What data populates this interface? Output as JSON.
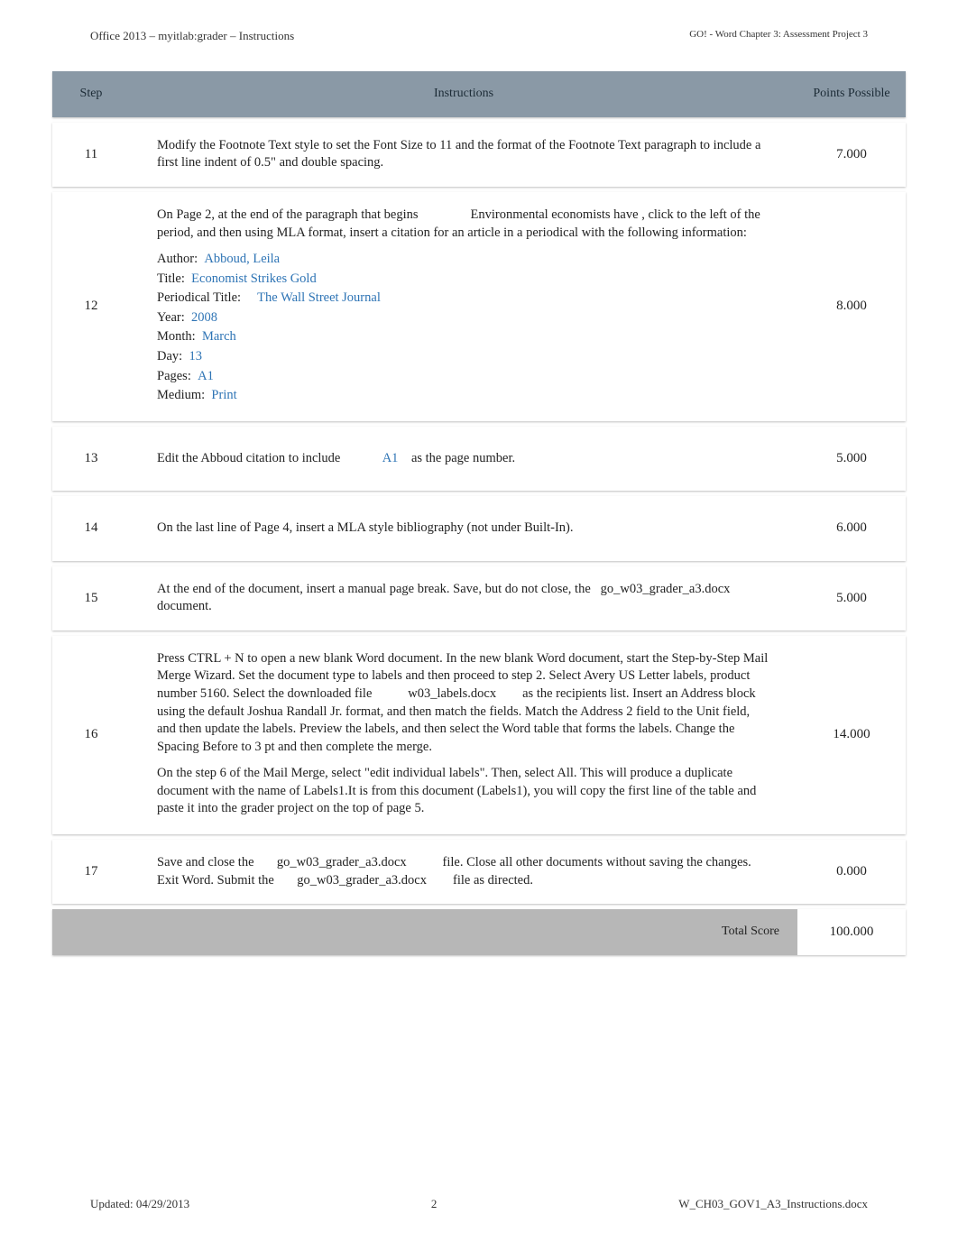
{
  "header": {
    "left": "Office 2013 – myitlab:grader – Instructions",
    "right": "GO! - Word Chapter 3: Assessment Project 3"
  },
  "table": {
    "headers": {
      "step": "Step",
      "instructions": "Instructions",
      "points": "Points Possible"
    },
    "total_label": "Total Score",
    "total_value": "100.000"
  },
  "rows": {
    "r11": {
      "step": "11",
      "points": "7.000",
      "text": "Modify the Footnote Text style to set the Font Size to 11 and the format of the Footnote Text paragraph to include a first line indent of 0.5\" and double spacing."
    },
    "r12": {
      "step": "12",
      "points": "8.000",
      "intro_a": "On Page 2, at the end of the paragraph that begins",
      "intro_b": "Environmental economists have",
      "intro_c": ", click to the left of the period, and then using MLA format, insert a citation for an article in a periodical with the following information:",
      "author_lbl": "Author:",
      "author_val": "Abboud, Leila",
      "title_lbl": "Title:",
      "title_val": "Economist Strikes Gold",
      "ptitle_lbl": "Periodical Title:",
      "ptitle_val": "The Wall Street Journal",
      "year_lbl": "Year:",
      "year_val": "2008",
      "month_lbl": "Month:",
      "month_val": "March",
      "day_lbl": "Day:",
      "day_val": "13",
      "pages_lbl": "Pages:",
      "pages_val": "A1",
      "medium_lbl": "Medium:",
      "medium_val": "Print"
    },
    "r13": {
      "step": "13",
      "points": "5.000",
      "a": "Edit the Abboud citation to include",
      "b": "A1",
      "c": "as the page number."
    },
    "r14": {
      "step": "14",
      "points": "6.000",
      "text": "On the last line of Page 4, insert a MLA style bibliography (not under Built-In)."
    },
    "r15": {
      "step": "15",
      "points": "5.000",
      "a": "At the end of the document, insert a manual page break. Save, but do not close, the",
      "b": "go_w03_grader_a3.docx",
      "c": "document."
    },
    "r16": {
      "step": "16",
      "points": "14.000",
      "p1a": "Press CTRL + N to open a new blank Word document. In the new blank Word document, start the Step-by-Step Mail Merge Wizard. Set the document type to labels and then proceed to step 2. Select Avery US Letter labels, product number 5160. Select the downloaded file",
      "p1b": "w03_labels.docx",
      "p1c": "as the recipients list. Insert an Address block using the default Joshua Randall Jr. format, and then match the fields. Match the Address 2 field to the Unit field, and then update the labels. Preview the labels, and then select the Word table that forms the labels. Change the Spacing Before to 3 pt and then complete the merge.",
      "p2": "On the step 6 of the Mail Merge, select \"edit individual labels\". Then, select All. This will produce a duplicate document with the name of Labels1.It is from this document (Labels1), you will copy the first line of the table and paste it into the grader project on the top of page 5."
    },
    "r17": {
      "step": "17",
      "points": "0.000",
      "a": "Save and close the",
      "b": "go_w03_grader_a3.docx",
      "c": "file. Close all other documents without saving the changes. Exit Word. Submit the",
      "d": "go_w03_grader_a3.docx",
      "e": "file as directed."
    }
  },
  "footer": {
    "updated": "Updated: 04/29/2013",
    "page": "2",
    "filename": "W_CH03_GOV1_A3_Instructions.docx"
  }
}
